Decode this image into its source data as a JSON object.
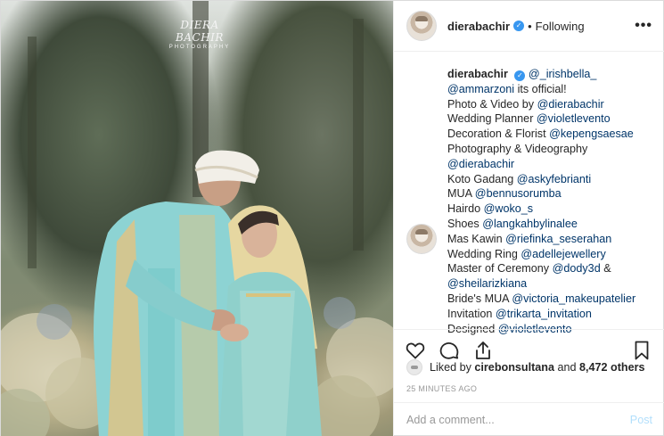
{
  "photo": {
    "watermark_title": "DIERA BACHIR",
    "watermark_subtitle": "PHOTOGRAPHY"
  },
  "header": {
    "username": "dierabachir",
    "verified_icon": "verified-badge-icon",
    "separator": "•",
    "follow_status": "Following",
    "more_icon": "more-options-icon",
    "more_label": "•••"
  },
  "caption": {
    "username": "dierabachir",
    "lines": [
      {
        "pre": "",
        "tag": "@_irishbella_",
        "post": ""
      },
      {
        "pre": "",
        "tag": "@ammarzoni",
        "post": " its official!"
      },
      {
        "pre": "Photo & Video by ",
        "tag": "@dierabachir",
        "post": ""
      },
      {
        "pre": "Wedding Planner ",
        "tag": "@violetlevento",
        "post": ""
      },
      {
        "pre": "Decoration & Florist ",
        "tag": "@kepengsaesae",
        "post": ""
      },
      {
        "pre": "Photography & Videography",
        "tag": "",
        "post": ""
      },
      {
        "pre": "",
        "tag": "@dierabachir",
        "post": ""
      },
      {
        "pre": "Koto Gadang ",
        "tag": "@askyfebrianti",
        "post": ""
      },
      {
        "pre": "MUA ",
        "tag": "@bennusorumba",
        "post": ""
      },
      {
        "pre": "Hairdo ",
        "tag": "@woko_s",
        "post": ""
      },
      {
        "pre": "Shoes ",
        "tag": "@langkahbylinalee",
        "post": ""
      },
      {
        "pre": "Mas Kawin ",
        "tag": "@riefinka_seserahan",
        "post": ""
      },
      {
        "pre": "Wedding Ring ",
        "tag": "@adellejewellery",
        "post": ""
      },
      {
        "pre": "Master of Ceremony ",
        "tag": "@dody3d",
        "post": " &"
      },
      {
        "pre": "",
        "tag": "@sheilarizkiana",
        "post": ""
      },
      {
        "pre": "Bride's MUA ",
        "tag": "@victoria_makeupatelier",
        "post": ""
      },
      {
        "pre": "Invitation ",
        "tag": "@trikarta_invitation",
        "post": ""
      },
      {
        "pre": "Designed ",
        "tag": "@violetlevento",
        "post": ""
      }
    ]
  },
  "actions": {
    "like_icon": "heart-icon",
    "comment_icon": "comment-icon",
    "share_icon": "share-icon",
    "save_icon": "bookmark-icon"
  },
  "likes": {
    "prefix": "Liked by ",
    "user": "cirebonsultana",
    "middle": " and ",
    "count": "8,472 others"
  },
  "timestamp": "25 MINUTES AGO",
  "comment": {
    "placeholder": "Add a comment...",
    "post_label": "Post"
  },
  "colors": {
    "link": "#003569",
    "verified": "#3897f0",
    "post_disabled": "#b2dffc",
    "border": "#efefef"
  }
}
